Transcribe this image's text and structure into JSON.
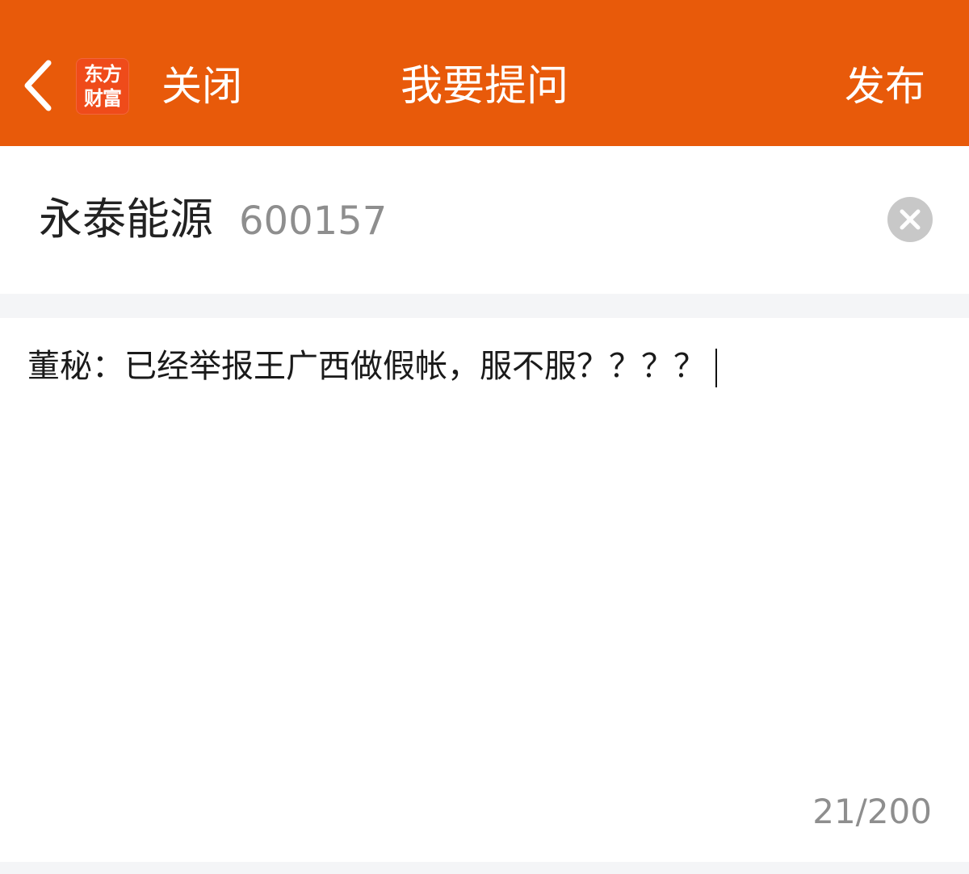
{
  "header": {
    "close_label": "关闭",
    "title": "我要提问",
    "publish_label": "发布",
    "logo_line1": "东方",
    "logo_line2": "财富",
    "background_color": "#e85a0a"
  },
  "stock": {
    "name": "永泰能源",
    "code": "600157"
  },
  "question": {
    "value": "董秘：已经举报王广西做假帐，服不服？？？？",
    "char_count": "21/200"
  },
  "icons": {
    "back": "chevron-left-icon",
    "logo": "app-logo-icon",
    "clear": "close-circle-icon"
  }
}
